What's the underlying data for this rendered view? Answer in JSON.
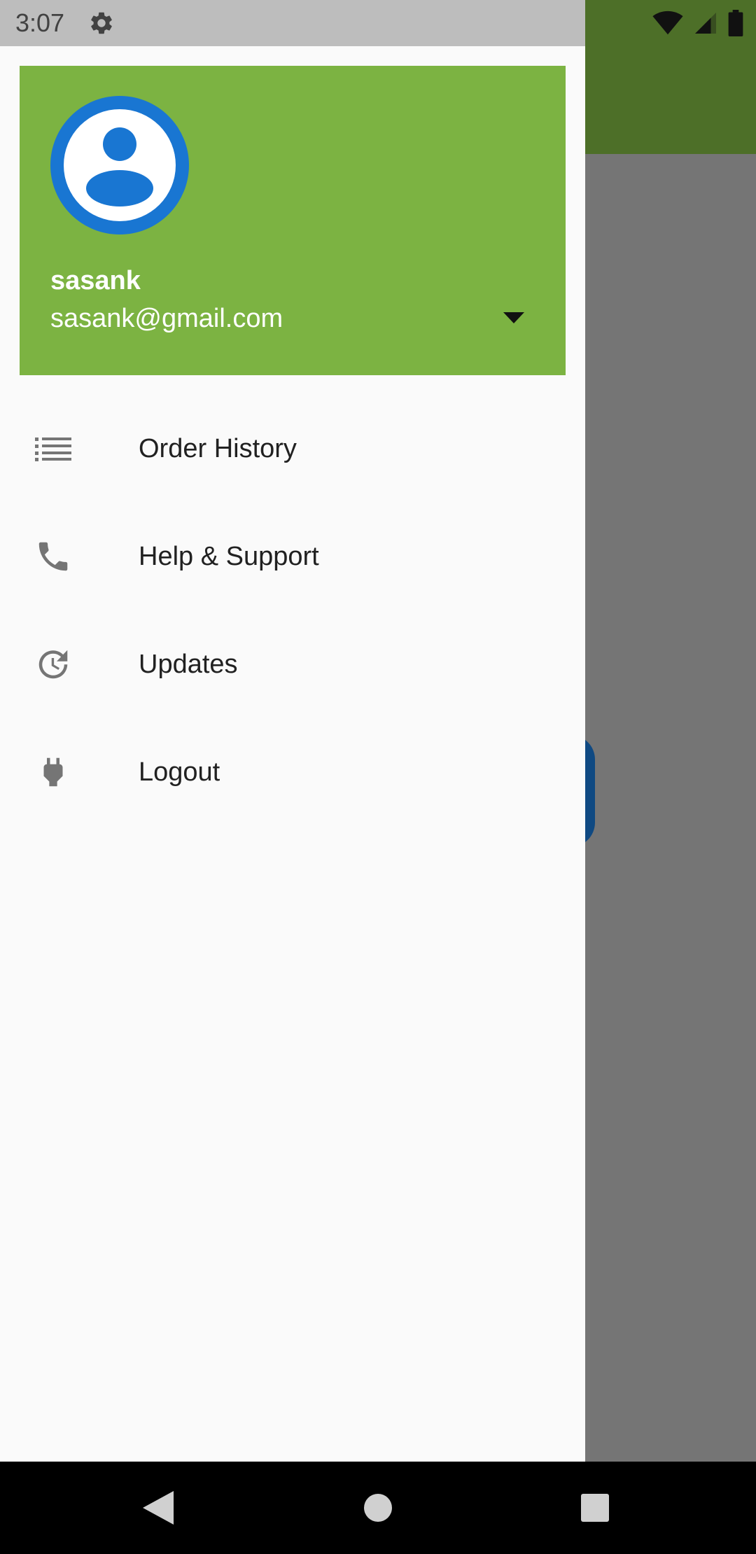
{
  "status_bar": {
    "time": "3:07",
    "icons": [
      "settings-icon",
      "wifi-icon",
      "signal-icon",
      "battery-icon"
    ]
  },
  "drawer": {
    "header": {
      "name": "sasank",
      "email": "sasank@gmail.com",
      "header_color": "#7cb342",
      "avatar_color": "#1976d2"
    },
    "items": [
      {
        "label": "Order History",
        "icon": "list-icon"
      },
      {
        "label": "Help & Support",
        "icon": "phone-icon"
      },
      {
        "label": "Updates",
        "icon": "update-icon"
      },
      {
        "label": "Logout",
        "icon": "plug-icon"
      }
    ]
  },
  "nav_bar": {
    "buttons": [
      "back-icon",
      "home-icon",
      "recents-icon"
    ]
  }
}
